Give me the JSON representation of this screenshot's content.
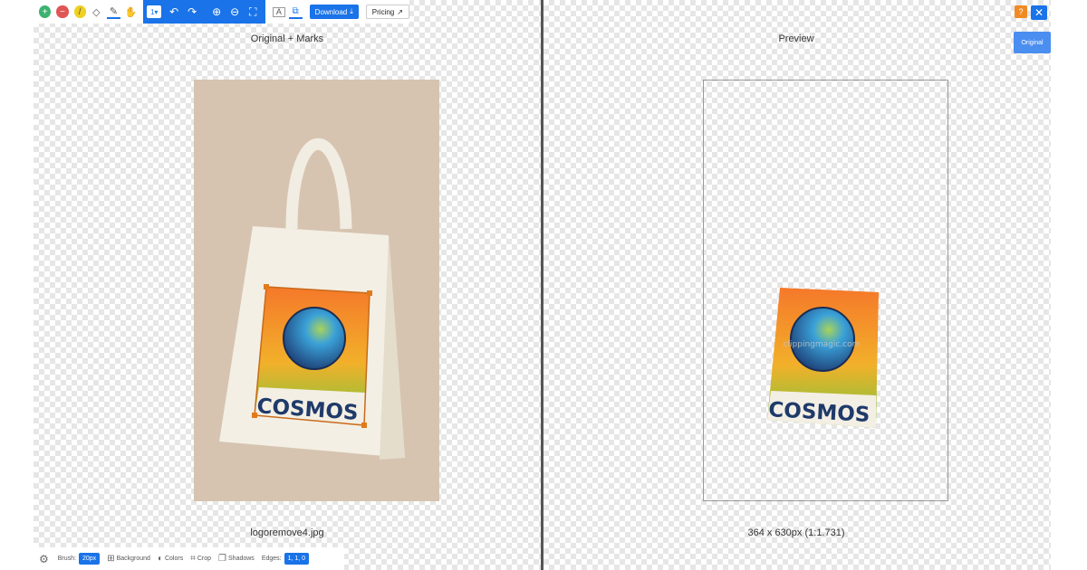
{
  "toolbar": {
    "zoom_select": "1",
    "download_label": "Download",
    "download_icon": "download-icon",
    "pricing_label": "Pricing",
    "pricing_icon": "external-link-icon"
  },
  "left_pane": {
    "title": "Original + Marks",
    "filename": "logoremove4.jpg"
  },
  "right_pane": {
    "title": "Preview",
    "dimensions": "364 x 630px (1:1.731)"
  },
  "top_right": {
    "help_label": "?",
    "close_label": "✕",
    "original_label": "Original"
  },
  "logo": {
    "text": "COSMOS",
    "watermark": "clippingmagic.com"
  },
  "bottom_bar": {
    "brush_label": "Brush:",
    "brush_value": "20px",
    "background_label": "Background",
    "colors_label": "Colors",
    "crop_label": "Crop",
    "shadows_label": "Shadows",
    "edges_label": "Edges:",
    "edges_value": "1, 1, 0"
  },
  "colors": {
    "accent": "#1a73e8",
    "image_bg": "#d6c4b0",
    "help_orange": "#f08a24",
    "mark_orange": "#e07a1a"
  }
}
